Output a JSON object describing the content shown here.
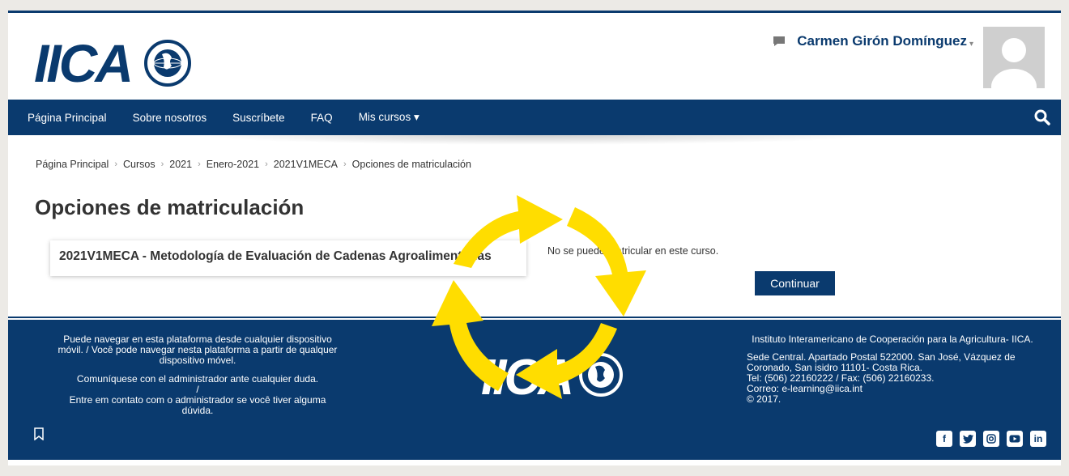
{
  "header": {
    "logo_text": "IICA",
    "user_name": "Carmen Girón Domínguez",
    "user_caret": "▾"
  },
  "nav": {
    "items": [
      "Página Principal",
      "Sobre nosotros",
      "Suscríbete",
      "FAQ",
      "Mis cursos ▾"
    ]
  },
  "breadcrumb": [
    "Página Principal",
    "Cursos",
    "2021",
    "Enero-2021",
    "2021V1MECA",
    "Opciones de matriculación"
  ],
  "breadcrumb_separator": "›",
  "main": {
    "title": "Opciones de matriculación",
    "course_name": "2021V1MECA - Metodología de Evaluación de Cadenas Agroalimentarias",
    "notice": "No se puede matricular en este curso.",
    "continue_label": "Continuar"
  },
  "footer": {
    "left_p1": "Puede navegar en esta plataforma desde cualquier dispositivo móvil. / Você pode navegar nesta plataforma a partir de qualquer dispositivo móvel.",
    "left_p2": "Comuníquese con el administrador ante cualquier duda.",
    "left_p3": "/",
    "left_p4": "Entre em contato com o administrador se você tiver alguma dúvida.",
    "institute": "Instituto Interamericano de Cooperación para la Agricultura- IICA.",
    "address": "Sede Central. Apartado Postal 522000. San José, Vázquez de Coronado, San isidro 11101- Costa Rica.",
    "phone": "Tel: (506) 22160222 / Fax: (506) 22160233.",
    "email": "Correo: e-learning@iica.int",
    "copyright": " © 2017.",
    "logo_text": "IICA",
    "social": [
      "facebook-icon",
      "twitter-icon",
      "instagram-icon",
      "youtube-icon",
      "linkedin-icon"
    ]
  },
  "colors": {
    "primary": "#0a3a6e",
    "overlay_arrows": "#ffdd00"
  }
}
